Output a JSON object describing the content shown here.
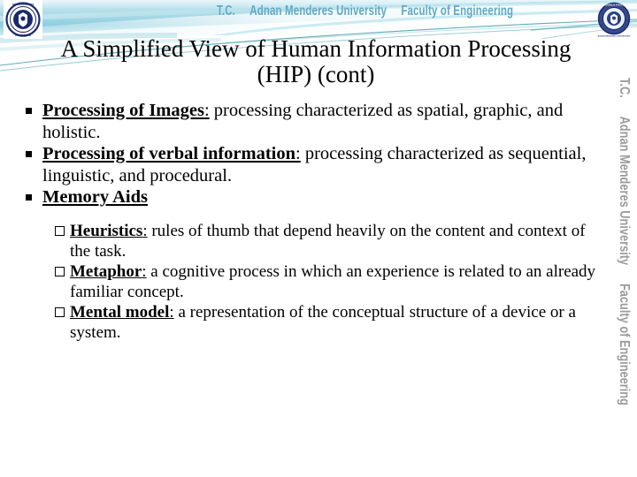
{
  "header": {
    "text_part1": "T.C.",
    "text_part2": "Adnan Menderes University",
    "text_part3": "Faculty of Engineering",
    "band_color": "#a8d9e6",
    "text_color": "#5fa8c4",
    "left_logo_name": "adnan-menderes-university-seal",
    "right_logo_name": "faculty-of-engineering-seal"
  },
  "watermark": {
    "text_part1": "T.C.",
    "text_part2": "Adnan Menderes University",
    "text_part3": "Faculty of Engineering",
    "color": "#9b9b9b"
  },
  "slide": {
    "title_line1": "A Simplified View of Human Information Processing",
    "title_line2": "(HIP) (cont)"
  },
  "bullets": [
    {
      "marker": "filled-square",
      "lead": "Processing of Images",
      "lead_punct": ":",
      "body": " processing characterized as spatial, graphic, and holistic."
    },
    {
      "marker": "filled-square",
      "lead": "Processing of verbal information",
      "lead_punct": ":",
      "body": " processing characterized as sequential, linguistic, and procedural."
    },
    {
      "marker": "filled-square",
      "lead": "Memory Aids",
      "lead_punct": "",
      "body": ""
    }
  ],
  "sub_bullets": [
    {
      "marker": "hollow-square",
      "lead": "Heuristics",
      "lead_punct": ":",
      "body": " rules of thumb that depend heavily on the content and context of the task."
    },
    {
      "marker": "hollow-square",
      "lead": "Metaphor",
      "lead_punct": ":",
      "body": " a cognitive process in which an experience is related to an already familiar concept."
    },
    {
      "marker": "hollow-square",
      "lead": "Mental model",
      "lead_punct": ":",
      "body": " a representation of the conceptual structure of a device or a system."
    }
  ]
}
